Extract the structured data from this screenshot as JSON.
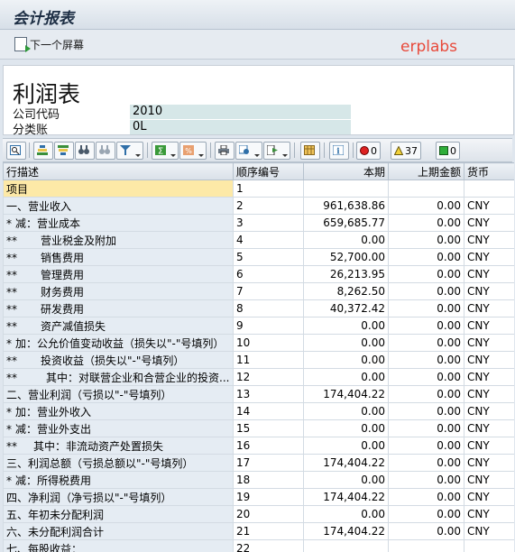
{
  "window": {
    "title": "会计报表"
  },
  "toolbar": {
    "next_screen_label": "下一个屏幕"
  },
  "watermark": "erplabs",
  "header": {
    "report_title": "利润表",
    "company_code_label": "公司代码",
    "company_code_value": "2010",
    "category_label": "分类账",
    "category_value": "0L"
  },
  "alv_toolbar": {
    "icons": [
      "details-icon",
      "sort-ascending-icon",
      "sort-descending-icon",
      "find-icon",
      "find-next-icon",
      "filter-icon",
      "sum-icon",
      "subtotal-icon",
      "print-icon",
      "view-icon",
      "export-icon",
      "layout-icon",
      "info-icon"
    ],
    "red_count": "0",
    "yellow_count": "37",
    "green_count": "0"
  },
  "table": {
    "columns": [
      "行描述",
      "顺序编号",
      "本期",
      "上期金额",
      "货币"
    ],
    "rows": [
      {
        "prefix": "",
        "indent": 0,
        "desc": "项目",
        "seq": "1",
        "cur": "",
        "prev": "",
        "curr": ""
      },
      {
        "prefix": "",
        "indent": 0,
        "desc": "一、营业收入",
        "seq": "2",
        "cur": "961,638.86",
        "prev": "0.00",
        "curr": "CNY"
      },
      {
        "prefix": "*",
        "indent": 0,
        "desc": "减：营业成本",
        "seq": "3",
        "cur": "659,685.77",
        "prev": "0.00",
        "curr": "CNY"
      },
      {
        "prefix": "**",
        "indent": 26,
        "desc": "营业税金及附加",
        "seq": "4",
        "cur": "0.00",
        "prev": "0.00",
        "curr": "CNY"
      },
      {
        "prefix": "**",
        "indent": 26,
        "desc": "销售费用",
        "seq": "5",
        "cur": "52,700.00",
        "prev": "0.00",
        "curr": "CNY"
      },
      {
        "prefix": "**",
        "indent": 26,
        "desc": "管理费用",
        "seq": "6",
        "cur": "26,213.95",
        "prev": "0.00",
        "curr": "CNY"
      },
      {
        "prefix": "**",
        "indent": 26,
        "desc": "财务费用",
        "seq": "7",
        "cur": "8,262.50",
        "prev": "0.00",
        "curr": "CNY"
      },
      {
        "prefix": "**",
        "indent": 26,
        "desc": "研发费用",
        "seq": "8",
        "cur": "40,372.42",
        "prev": "0.00",
        "curr": "CNY"
      },
      {
        "prefix": "**",
        "indent": 26,
        "desc": "资产减值损失",
        "seq": "9",
        "cur": "0.00",
        "prev": "0.00",
        "curr": "CNY"
      },
      {
        "prefix": "*",
        "indent": 0,
        "desc": "加：公允价值变动收益（损失以\"-\"号填列）",
        "seq": "10",
        "cur": "0.00",
        "prev": "0.00",
        "curr": "CNY"
      },
      {
        "prefix": "**",
        "indent": 26,
        "desc": "投资收益（损失以\"-\"号填列）",
        "seq": "11",
        "cur": "0.00",
        "prev": "0.00",
        "curr": "CNY"
      },
      {
        "prefix": "**",
        "indent": 32,
        "desc": "其中：对联营企业和合营企业的投资...",
        "seq": "12",
        "cur": "0.00",
        "prev": "0.00",
        "curr": "CNY"
      },
      {
        "prefix": "",
        "indent": 0,
        "desc": "二、营业利润（亏损以\"-\"号填列）",
        "seq": "13",
        "cur": "174,404.22",
        "prev": "0.00",
        "curr": "CNY"
      },
      {
        "prefix": "*",
        "indent": 0,
        "desc": "加：营业外收入",
        "seq": "14",
        "cur": "0.00",
        "prev": "0.00",
        "curr": "CNY"
      },
      {
        "prefix": "*",
        "indent": 0,
        "desc": "减：营业外支出",
        "seq": "15",
        "cur": "0.00",
        "prev": "0.00",
        "curr": "CNY"
      },
      {
        "prefix": "**",
        "indent": 18,
        "desc": "其中：非流动资产处置损失",
        "seq": "16",
        "cur": "0.00",
        "prev": "0.00",
        "curr": "CNY"
      },
      {
        "prefix": "",
        "indent": 0,
        "desc": "三、利润总额（亏损总额以\"-\"号填列）",
        "seq": "17",
        "cur": "174,404.22",
        "prev": "0.00",
        "curr": "CNY"
      },
      {
        "prefix": "*",
        "indent": 0,
        "desc": "减：所得税费用",
        "seq": "18",
        "cur": "0.00",
        "prev": "0.00",
        "curr": "CNY"
      },
      {
        "prefix": "",
        "indent": 0,
        "desc": "四、净利润（净亏损以\"-\"号填列）",
        "seq": "19",
        "cur": "174,404.22",
        "prev": "0.00",
        "curr": "CNY"
      },
      {
        "prefix": "",
        "indent": 0,
        "desc": "五、年初未分配利润",
        "seq": "20",
        "cur": "0.00",
        "prev": "0.00",
        "curr": "CNY"
      },
      {
        "prefix": "",
        "indent": 0,
        "desc": "六、未分配利润合计",
        "seq": "21",
        "cur": "174,404.22",
        "prev": "0.00",
        "curr": "CNY"
      },
      {
        "prefix": "",
        "indent": 0,
        "desc": "七、每股收益：",
        "seq": "22",
        "cur": "",
        "prev": "",
        "curr": ""
      }
    ]
  }
}
